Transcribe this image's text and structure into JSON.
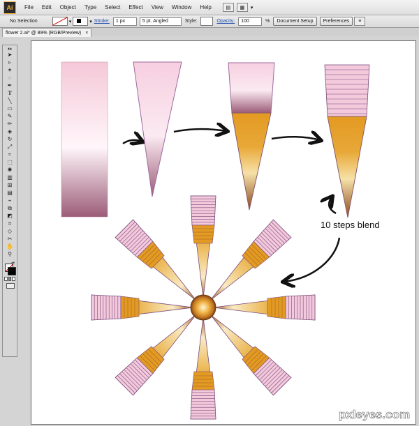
{
  "menubar": {
    "logo": "Ai",
    "items": [
      "File",
      "Edit",
      "Object",
      "Type",
      "Select",
      "Effect",
      "View",
      "Window",
      "Help"
    ]
  },
  "controlbar": {
    "selection": "No Selection",
    "stroke_label": "Stroke:",
    "stroke_weight": "1 px",
    "brush": "5 pt. Angled",
    "style_label": "Style:",
    "opacity_label": "Opacity:",
    "opacity_value": "100",
    "opacity_unit": "%",
    "document_setup": "Document Setup",
    "preferences": "Preferences"
  },
  "tab": {
    "title": "flower 2.ai* @ 89% (RGB/Preview)",
    "close": "×"
  },
  "tools": [
    "selection-tool",
    "direct-selection-tool",
    "magic-wand-tool",
    "lasso-tool",
    "pen-tool",
    "type-tool",
    "line-tool",
    "rectangle-tool",
    "paintbrush-tool",
    "pencil-tool",
    "eraser-tool",
    "rotate-tool",
    "scale-tool",
    "warp-tool",
    "free-transform-tool",
    "symbol-sprayer-tool",
    "graph-tool",
    "mesh-tool",
    "gradient-tool",
    "eyedropper-tool",
    "blend-tool",
    "live-paint-tool",
    "crop-tool",
    "slice-tool",
    "scissors-tool",
    "hand-tool",
    "zoom-tool"
  ],
  "canvas": {
    "annotation": "10 steps blend",
    "watermark": "pxleyes.com",
    "colors": {
      "pink_light": "#f7d3e1",
      "pink_mid": "#e6a8c2",
      "mauve": "#9c5c78",
      "orange": "#e39a22",
      "cream": "#f6e1a8",
      "brown": "#8b4a1f",
      "outline": "#7a4a7a"
    }
  }
}
